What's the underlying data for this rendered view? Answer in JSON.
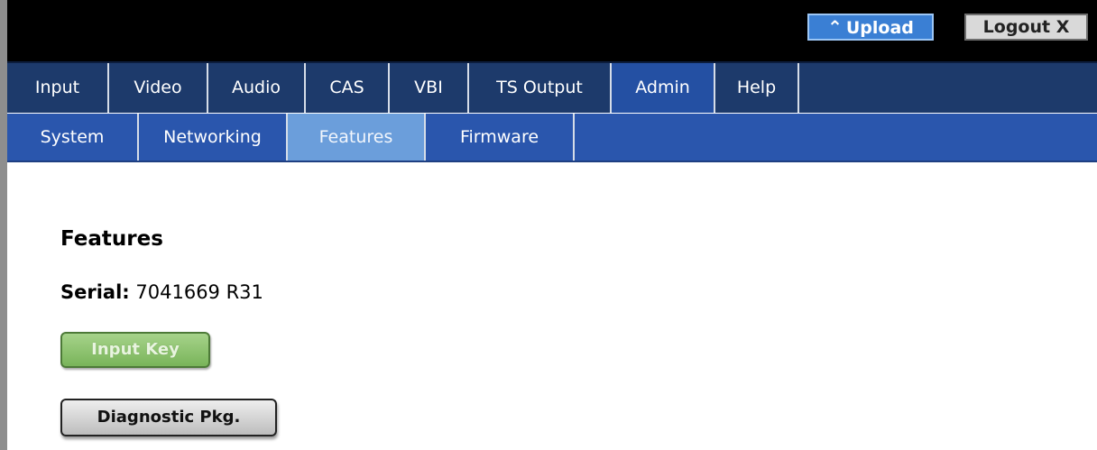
{
  "header": {
    "upload_icon": "double-chevron-up-icon",
    "upload_label": "Upload",
    "logout_label": "Logout X"
  },
  "main_nav": {
    "tabs": [
      {
        "label": "Input"
      },
      {
        "label": "Video"
      },
      {
        "label": "Audio"
      },
      {
        "label": "CAS"
      },
      {
        "label": "VBI"
      },
      {
        "label": "TS Output"
      },
      {
        "label": "Admin"
      },
      {
        "label": "Help"
      }
    ],
    "active": "Admin"
  },
  "sub_nav": {
    "tabs": [
      {
        "label": "System"
      },
      {
        "label": "Networking"
      },
      {
        "label": "Features"
      },
      {
        "label": "Firmware"
      }
    ],
    "active": "Features"
  },
  "content": {
    "title": "Features",
    "serial_label": "Serial:",
    "serial_value": "7041669 R31",
    "input_key_label": "Input Key",
    "diagnostic_label": "Diagnostic Pkg."
  },
  "colors": {
    "topbar": "#000000",
    "main_nav": "#1d3a6b",
    "main_nav_active": "#2450a3",
    "sub_nav": "#2a56ad",
    "sub_nav_active": "#6b9edb",
    "upload_button": "#3a7fd4",
    "input_key_button": "#8cc36e"
  }
}
